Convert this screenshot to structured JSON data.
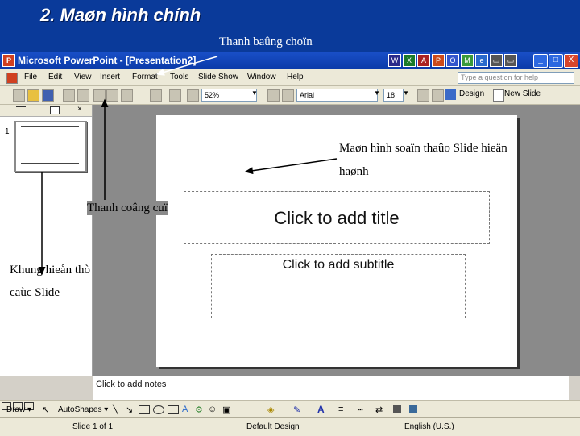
{
  "heading": "2. Maøn hình chính",
  "annotations": {
    "menubar": "Thanh baûng choïn",
    "editor": "Maøn hình soaïn thaûo Slide hieän haønh",
    "toolbar": "Thanh coâng cuï",
    "thumbnails": "Khung hieån thò caùc Slide"
  },
  "window": {
    "app_icon": "P",
    "title": "Microsoft PowerPoint - [Presentation2]",
    "controls": {
      "minimize": "_",
      "maximize": "□",
      "close": "X"
    }
  },
  "menu": {
    "items": [
      "File",
      "Edit",
      "View",
      "Insert",
      "Format",
      "Tools",
      "Slide Show",
      "Window",
      "Help"
    ],
    "help_placeholder": "Type a question for help"
  },
  "toolbar": {
    "zoom": "52%",
    "font": "Arial",
    "font_size": "18",
    "design_label": "Design",
    "new_slide_label": "New Slide"
  },
  "slide_pane": {
    "slide_number": "1"
  },
  "slide": {
    "title_placeholder": "Click to add title",
    "subtitle_placeholder": "Click to add subtitle"
  },
  "notes_placeholder": "Click to add notes",
  "drawing": {
    "draw_label": "Draw ▾",
    "autoshapes_label": "AutoShapes ▾"
  },
  "status": {
    "slide_info": "Slide 1 of 1",
    "design": "Default Design",
    "language": "English (U.S.)"
  }
}
